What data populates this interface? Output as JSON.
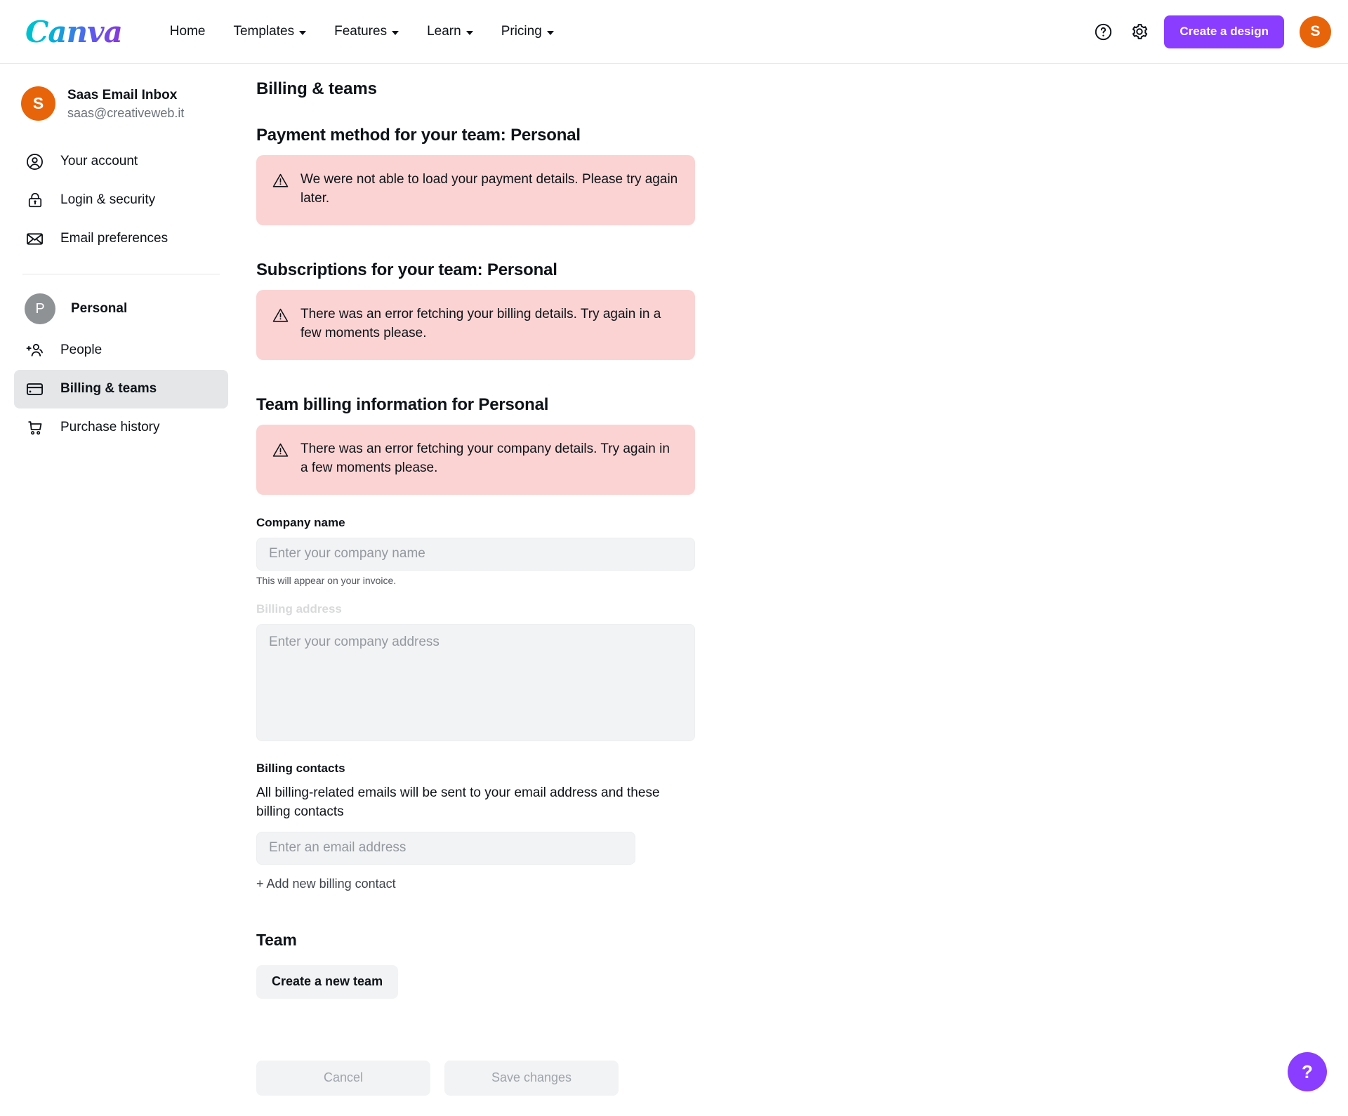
{
  "topnav": {
    "logo_text": "Canva",
    "links": [
      {
        "label": "Home",
        "has_caret": false
      },
      {
        "label": "Templates",
        "has_caret": true
      },
      {
        "label": "Features",
        "has_caret": true
      },
      {
        "label": "Learn",
        "has_caret": true
      },
      {
        "label": "Pricing",
        "has_caret": true
      }
    ],
    "help_icon": "question-circle-icon",
    "settings_icon": "gear-icon",
    "create_button": "Create a design",
    "avatar_initial": "S"
  },
  "sidebar": {
    "user": {
      "avatar_initial": "S",
      "name": "Saas Email Inbox",
      "email": "saas@creativeweb.it"
    },
    "account_items": [
      {
        "label": "Your account",
        "icon": "user-circle-icon"
      },
      {
        "label": "Login & security",
        "icon": "lock-icon"
      },
      {
        "label": "Email preferences",
        "icon": "envelope-icon"
      }
    ],
    "team": {
      "avatar_initial": "P",
      "name": "Personal"
    },
    "team_items": [
      {
        "label": "People",
        "icon": "add-people-icon",
        "active": false
      },
      {
        "label": "Billing & teams",
        "icon": "credit-card-icon",
        "active": true
      },
      {
        "label": "Purchase history",
        "icon": "shopping-cart-icon",
        "active": false
      }
    ]
  },
  "main": {
    "page_title": "Billing & teams",
    "payment_section": {
      "title": "Payment method for your team: Personal",
      "alert": "We were not able to load your payment details. Please try again later."
    },
    "subscriptions_section": {
      "title": "Subscriptions for your team: Personal",
      "alert": "There was an error fetching your billing details. Try again in a few moments please."
    },
    "billing_info_section": {
      "title": "Team billing information for Personal",
      "alert": "There was an error fetching your company details. Try again in a few moments please.",
      "company_name_label": "Company name",
      "company_name_value": "",
      "company_name_placeholder": "Enter your company name",
      "company_name_hint": "This will appear on your invoice.",
      "billing_address_label": "Billing address",
      "billing_address_value": "",
      "billing_address_placeholder": "Enter your company address",
      "billing_contacts_label": "Billing contacts",
      "billing_contacts_desc": "All billing-related emails will be sent to your email address and these billing contacts",
      "billing_contacts_value": "",
      "billing_contacts_placeholder": "Enter an email address",
      "add_contact_link": "+ Add new billing contact"
    },
    "team_section": {
      "title": "Team",
      "create_team_button": "Create a new team"
    },
    "footer": {
      "cancel_label": "Cancel",
      "save_label": "Save changes"
    },
    "fab_label": "?"
  },
  "colors": {
    "brand_purple": "#8b3dff",
    "avatar_orange": "#e8640a",
    "alert_pink": "#fbd3d3",
    "active_nav_gray": "#e4e6e8"
  }
}
